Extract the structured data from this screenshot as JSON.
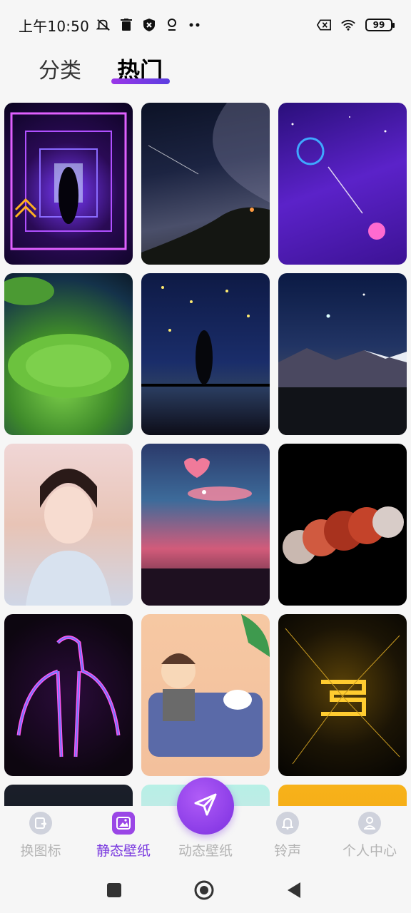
{
  "status_bar": {
    "time": "上午10:50",
    "battery": "99",
    "left_icons": [
      "mute-icon",
      "trash-icon",
      "shield-icon",
      "location-icon",
      "more-icon"
    ],
    "right_icons": [
      "no-sim-icon",
      "wifi-icon",
      "battery-icon"
    ]
  },
  "tabs": [
    {
      "label": "分类",
      "active": false
    },
    {
      "label": "热门",
      "active": true
    }
  ],
  "wallpapers": [
    {
      "theme": "neon purple tunnel"
    },
    {
      "theme": "milky way over mountain"
    },
    {
      "theme": "purple starry night"
    },
    {
      "theme": "lotus leaf with raindrops"
    },
    {
      "theme": "couple under fireflies"
    },
    {
      "theme": "starry sky over mountains"
    },
    {
      "theme": "girl in traditional dress"
    },
    {
      "theme": "sunset sky with heart"
    },
    {
      "theme": "lunar eclipse phases"
    },
    {
      "theme": "neon glowing human outline"
    },
    {
      "theme": "cartoon boy on sofa"
    },
    {
      "theme": "golden light burst"
    },
    {
      "theme": "dark"
    },
    {
      "theme": "pastel"
    },
    {
      "theme": "orange"
    }
  ],
  "bottom_nav": [
    {
      "label": "换图标",
      "icon": "change-icon-icon",
      "active": false
    },
    {
      "label": "静态壁纸",
      "icon": "static-wallpaper-icon",
      "active": true
    },
    {
      "label": "动态壁纸",
      "icon": "send-icon",
      "active": false
    },
    {
      "label": "铃声",
      "icon": "bell-icon",
      "active": false
    },
    {
      "label": "个人中心",
      "icon": "person-icon",
      "active": false
    }
  ],
  "colors": {
    "accent": "#7a3adf",
    "inactive": "#b4b4b4",
    "background": "#f6f6f6"
  }
}
